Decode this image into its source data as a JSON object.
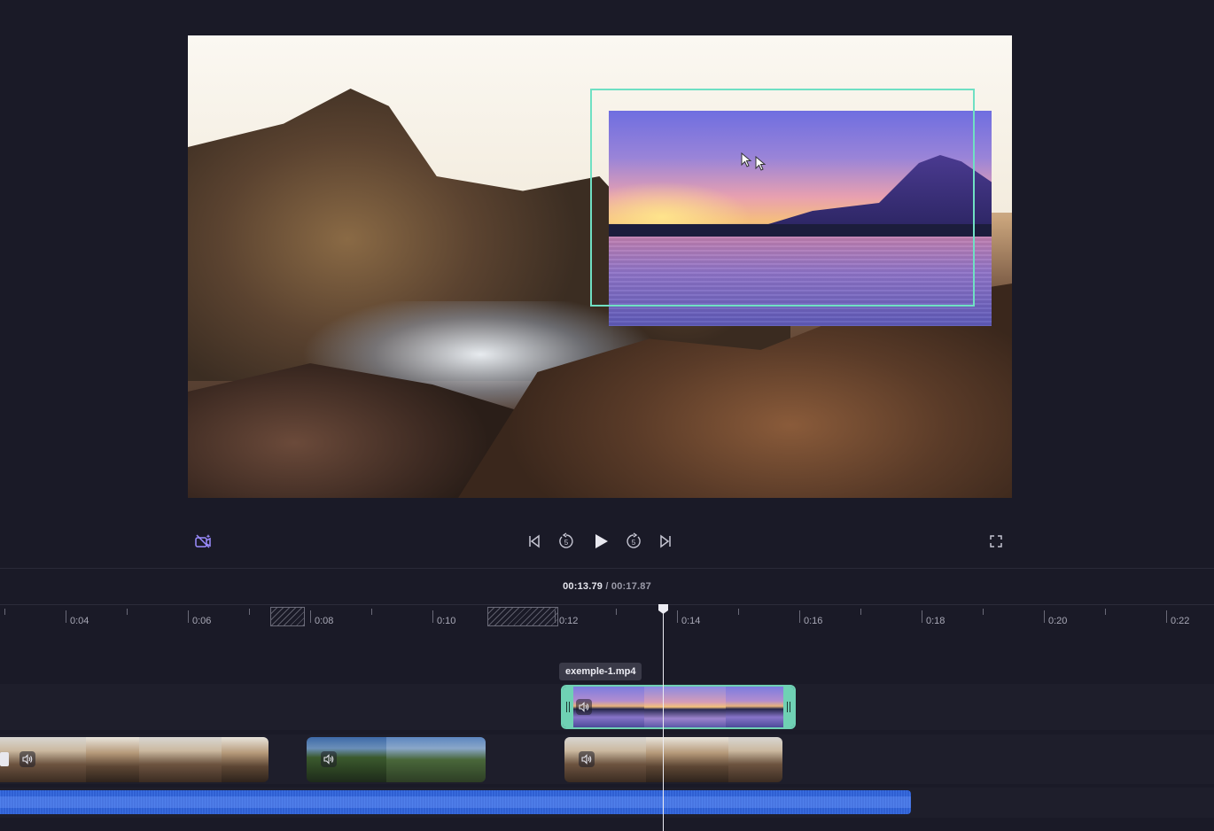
{
  "player": {
    "controls": {
      "magic_icon": "magic-sparkle-camera-icon",
      "prev_icon": "skip-to-start-icon",
      "back5_icon": "rewind-5-icon",
      "back5_label": "5",
      "play_icon": "play-icon",
      "fwd5_icon": "forward-5-icon",
      "fwd5_label": "5",
      "next_icon": "skip-to-end-icon",
      "fullscreen_icon": "fullscreen-icon"
    },
    "selection_color": "#6fe0c3"
  },
  "timeline": {
    "current_time": "00:13.79",
    "separator": " / ",
    "total_time": "00:17.87",
    "ruler_labels": [
      "0:04",
      "0:06",
      "0:08",
      "0:10",
      "0:12",
      "0:14",
      "0:16",
      "0:18",
      "0:20",
      "0:22"
    ],
    "hover_tooltip": "exemple-1.mp4",
    "accent_audio": "#3b6fe0",
    "selected_clip_color": "#6fd1b4"
  }
}
